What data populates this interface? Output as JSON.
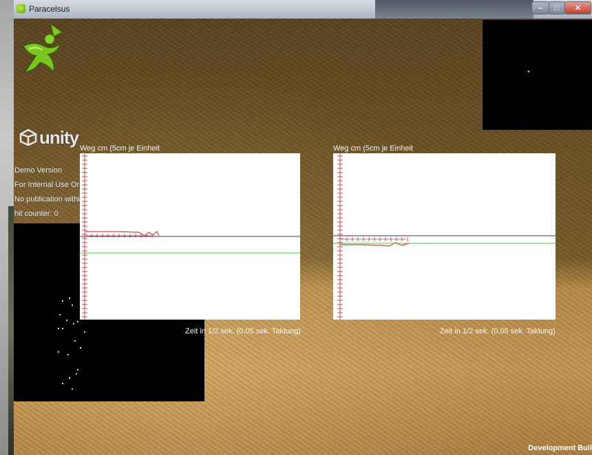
{
  "window": {
    "title": "Paracelsus",
    "minimize_glyph": "–",
    "maximize_glyph": "□",
    "close_glyph": "✕"
  },
  "logos": {
    "app_logo": "paracelsus-figure-logo",
    "engine_logo_text": "unity"
  },
  "hud": {
    "lines": [
      "Demo Version",
      "For Internal Use Or",
      "No publication withi",
      "hit counter: 0"
    ]
  },
  "plots": [
    {
      "title": "Weg cm (5cm je Einheit",
      "xlabel": "Zeit in 1/2 sek. (0,05 sek. Taktung)",
      "y_ticks": 40,
      "x_ticks_on_axis": 12,
      "reference_lines": [
        {
          "name": "black-line",
          "color": "#3a3a5a"
        },
        {
          "name": "green-line",
          "color": "#7fe07f"
        }
      ],
      "red_trace_color": "#c84848"
    },
    {
      "title": "Weg cm (5cm je Einheit",
      "xlabel": "Zeit in 1/2 sek. (0,05 sek. Taktung)",
      "y_ticks": 40,
      "x_ticks_on_axis": 12,
      "reference_lines": [
        {
          "name": "black-line",
          "color": "#3a3a5a"
        },
        {
          "name": "green-line",
          "color": "#7fe07f"
        }
      ],
      "red_trace_color": "#c84848"
    }
  ],
  "footer": {
    "dev_build": "Development Buil"
  },
  "colors": {
    "accent_green": "#7ac51f",
    "terrain_dark": "#5b4420",
    "terrain_light": "#c49653"
  }
}
